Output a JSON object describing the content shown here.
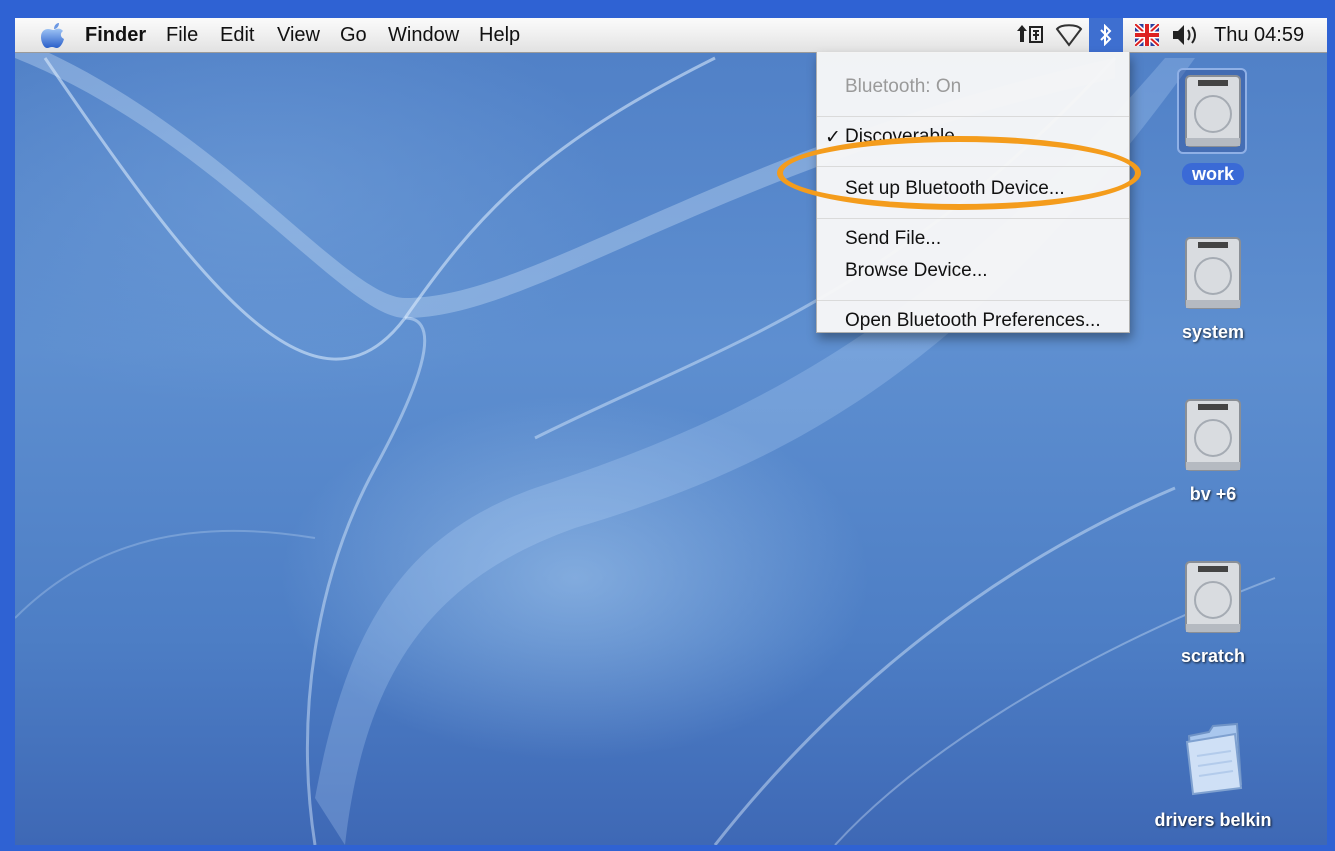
{
  "menubar": {
    "apple_icon": "apple-logo-icon",
    "app_name": "Finder",
    "menus": [
      "File",
      "Edit",
      "View",
      "Go",
      "Window",
      "Help"
    ],
    "status_icons": [
      "keyboard-input-icon",
      "airport-icon",
      "bluetooth-icon",
      "uk-flag-icon",
      "volume-icon"
    ],
    "clock": "Thu 04:59"
  },
  "bluetooth_menu": {
    "status": "Bluetooth: On",
    "discoverable": "Discoverable",
    "discoverable_checked": true,
    "setup": "Set up Bluetooth Device...",
    "send_file": "Send File...",
    "browse": "Browse Device...",
    "preferences": "Open Bluetooth Preferences...",
    "check_mark": "✓"
  },
  "annotation": {
    "highlight_color": "#f49c1c",
    "highlighted_item": "Set up Bluetooth Device..."
  },
  "desktop_icons": [
    {
      "label": "work",
      "type": "hard-drive-icon",
      "selected": true
    },
    {
      "label": "system",
      "type": "hard-drive-icon",
      "selected": false
    },
    {
      "label": "bv +6",
      "type": "hard-drive-icon",
      "selected": false
    },
    {
      "label": "scratch",
      "type": "hard-drive-icon",
      "selected": false
    },
    {
      "label": "drivers belkin",
      "type": "folder-icon",
      "selected": false
    }
  ],
  "colors": {
    "frame": "#2f62d3",
    "desktop": "#5e8fd0",
    "selection": "#3a6ad6"
  }
}
